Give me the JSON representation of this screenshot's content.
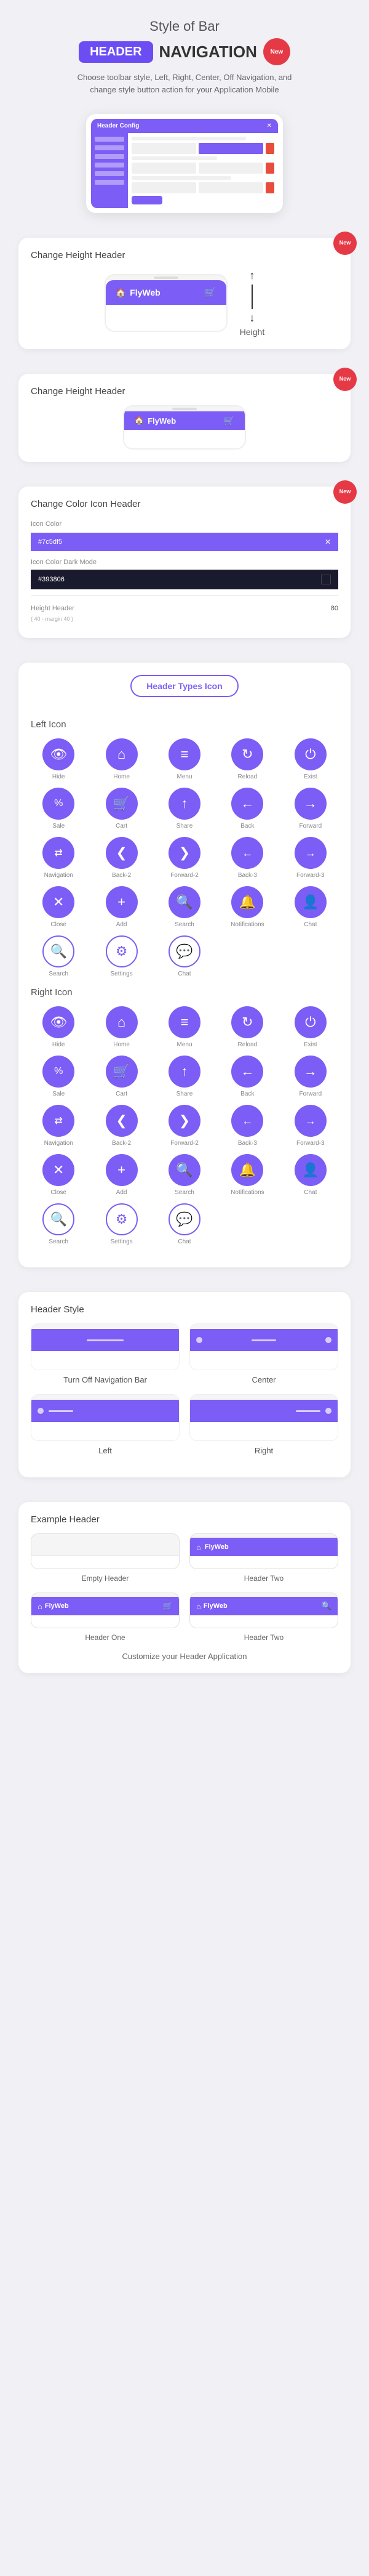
{
  "hero": {
    "title": "Style of Bar",
    "badge_header": "HEADER",
    "nav_text": "NAVIGATION",
    "new_badge": "New",
    "description": "Choose toolbar style, Left, Right, Center, Off Navigation, and change style button action for your Application Mobile"
  },
  "sections": {
    "change_height_1": {
      "title": "Change Height Header",
      "new_badge": "New",
      "arrow_label": "Height"
    },
    "change_height_2": {
      "title": "Change Height Header",
      "new_badge": "New"
    },
    "change_color": {
      "title": "Change Color Icon Header",
      "label_icon_color": "Icon Color",
      "color_purple": "#7c5df5",
      "label_icon_color_dark": "Icon Color Dark Mode",
      "color_dark": "#393806",
      "label_height_header": "Height Header",
      "height_value": "80",
      "height_hint": "( 40 - margin 40 )"
    },
    "header_types": {
      "title": "Header Types Icon",
      "left_icon_title": "Left Icon",
      "right_icon_title": "Right Icon"
    },
    "header_style": {
      "title": "Header Style",
      "items": [
        {
          "label": "Turn Off Navigation Bar"
        },
        {
          "label": "Center"
        },
        {
          "label": "Left"
        },
        {
          "label": "Right"
        }
      ]
    },
    "example_header": {
      "title": "Example Header",
      "items": [
        {
          "label": "Empty Header",
          "type": "empty"
        },
        {
          "label": "Header Two",
          "type": "purple"
        },
        {
          "label": "Header One",
          "type": "empty2"
        },
        {
          "label": "Header Two",
          "type": "purple2"
        }
      ],
      "customize_text": "Customize your Header Application"
    }
  },
  "icons": {
    "left": [
      {
        "name": "Hide",
        "symbol": "👁"
      },
      {
        "name": "Home",
        "symbol": "🏠"
      },
      {
        "name": "Menu",
        "symbol": "≡"
      },
      {
        "name": "Reload",
        "symbol": "↻"
      },
      {
        "name": "Exist",
        "symbol": "⏻"
      },
      {
        "name": "Sale",
        "symbol": "%"
      },
      {
        "name": "Cart",
        "symbol": "🛒"
      },
      {
        "name": "Share",
        "symbol": "↑"
      },
      {
        "name": "Back",
        "symbol": "←"
      },
      {
        "name": "Forward",
        "symbol": "→"
      },
      {
        "name": "Navigation",
        "symbol": "⇄"
      },
      {
        "name": "Back-2",
        "symbol": "❮"
      },
      {
        "name": "Forward-2",
        "symbol": "❯"
      },
      {
        "name": "Back-3",
        "symbol": "←"
      },
      {
        "name": "Forward-3",
        "symbol": "→"
      },
      {
        "name": "Close",
        "symbol": "✕"
      },
      {
        "name": "Add",
        "symbol": "+"
      },
      {
        "name": "Search",
        "symbol": "🔍"
      },
      {
        "name": "Notifications",
        "symbol": "🔔"
      },
      {
        "name": "Chat",
        "symbol": "👤"
      },
      {
        "name": "Search",
        "symbol": "🔍"
      },
      {
        "name": "Settings",
        "symbol": "⚙"
      },
      {
        "name": "Chat",
        "symbol": "💬"
      }
    ],
    "right": [
      {
        "name": "Hide",
        "symbol": "👁"
      },
      {
        "name": "Home",
        "symbol": "🏠"
      },
      {
        "name": "Menu",
        "symbol": "≡"
      },
      {
        "name": "Reload",
        "symbol": "↻"
      },
      {
        "name": "Exist",
        "symbol": "⏻"
      },
      {
        "name": "Sale",
        "symbol": "%"
      },
      {
        "name": "Cart",
        "symbol": "🛒"
      },
      {
        "name": "Share",
        "symbol": "↑"
      },
      {
        "name": "Back",
        "symbol": "←"
      },
      {
        "name": "Forward",
        "symbol": "→"
      },
      {
        "name": "Navigation",
        "symbol": "⇄"
      },
      {
        "name": "Back-2",
        "symbol": "❮"
      },
      {
        "name": "Forward-2",
        "symbol": "❯"
      },
      {
        "name": "Back-3",
        "symbol": "←"
      },
      {
        "name": "Forward-3",
        "symbol": "→"
      },
      {
        "name": "Close",
        "symbol": "✕"
      },
      {
        "name": "Add",
        "symbol": "+"
      },
      {
        "name": "Search",
        "symbol": "🔍"
      },
      {
        "name": "Notifications",
        "symbol": "🔔"
      },
      {
        "name": "Chat",
        "symbol": "👤"
      },
      {
        "name": "Search",
        "symbol": "🔍"
      },
      {
        "name": "Settings",
        "symbol": "⚙"
      },
      {
        "name": "Chat",
        "symbol": "💬"
      }
    ]
  },
  "flyweb_label": "FlyWeb",
  "header_one_label": "Header One",
  "header_two_label": "Header Two",
  "header_one_label2": "Header One",
  "header_two_label2": "Header Two"
}
